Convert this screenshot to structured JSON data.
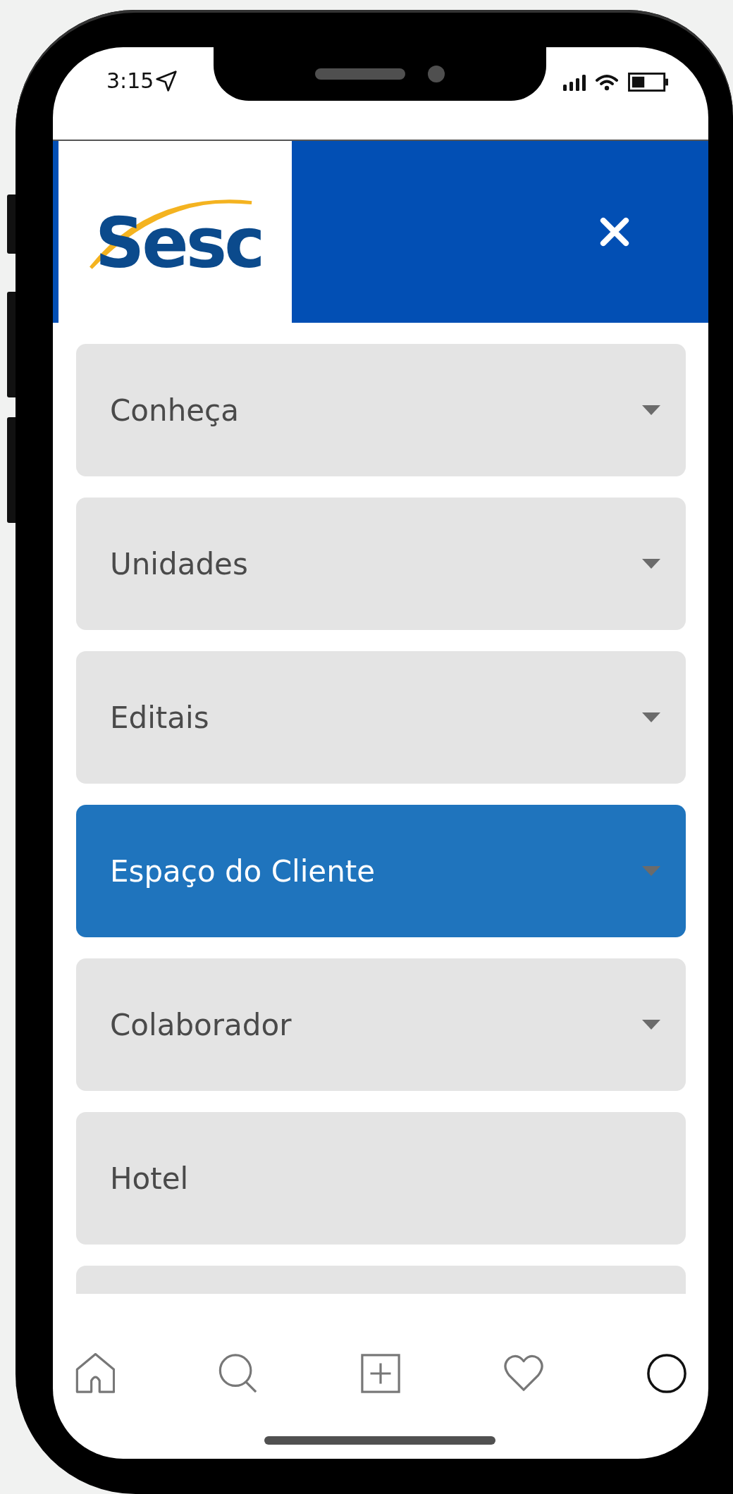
{
  "status_bar": {
    "time": "3:15"
  },
  "header": {
    "logo_text": "Sesc"
  },
  "menu": [
    {
      "label": "Conheça",
      "expandable": true,
      "selected": false
    },
    {
      "label": "Unidades",
      "expandable": true,
      "selected": false
    },
    {
      "label": "Editais",
      "expandable": true,
      "selected": false
    },
    {
      "label": "Espaço do Cliente",
      "expandable": true,
      "selected": true
    },
    {
      "label": "Colaborador",
      "expandable": true,
      "selected": false
    },
    {
      "label": "Hotel",
      "expandable": false,
      "selected": false
    },
    {
      "expandable": false,
      "selected": false
    }
  ],
  "tab_bar": [
    {
      "kind": "home"
    },
    {
      "kind": "search"
    },
    {
      "kind": "add"
    },
    {
      "kind": "heart"
    },
    {
      "kind": "profile"
    }
  ]
}
